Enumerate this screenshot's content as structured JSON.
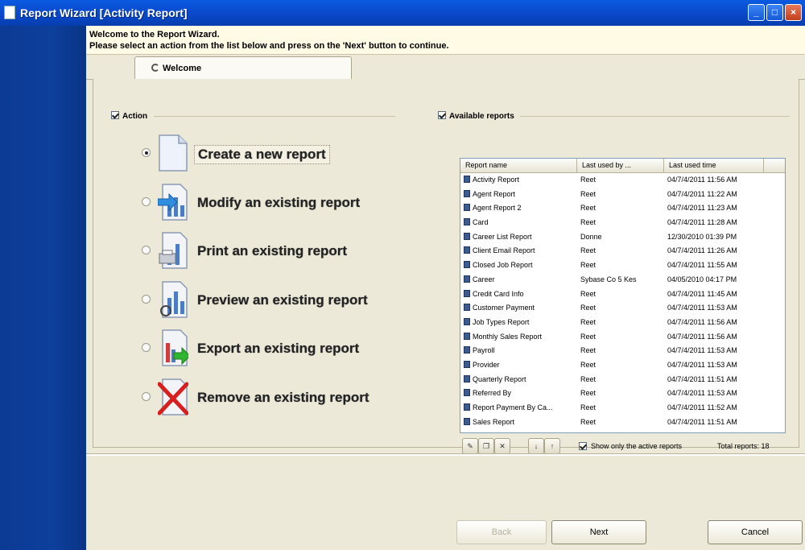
{
  "window": {
    "title": "Report Wizard [Activity Report]",
    "minimize": "_",
    "maximize": "□",
    "close": "×"
  },
  "header": {
    "line1": "Welcome to the Report Wizard.",
    "line2": "Please select an action from the list below and press on the 'Next' button to continue."
  },
  "tab": {
    "label": "Welcome"
  },
  "action_group": {
    "title": "Action"
  },
  "actions": [
    {
      "label": "Create a new report",
      "selected": true
    },
    {
      "label": "Modify an existing report",
      "selected": false
    },
    {
      "label": "Print an existing report",
      "selected": false
    },
    {
      "label": "Preview an existing report",
      "selected": false
    },
    {
      "label": "Export an existing report",
      "selected": false
    },
    {
      "label": "Remove an existing report",
      "selected": false
    }
  ],
  "reports_group": {
    "title": "Available reports"
  },
  "reports_table": {
    "columns": [
      "Report name",
      "Last used by ...",
      "Last used time"
    ],
    "rows": [
      [
        "Activity Report",
        "Reet",
        "04/7/4/2011 11:56 AM"
      ],
      [
        "Agent Report",
        "Reet",
        "04/7/4/2011 11:22 AM"
      ],
      [
        "Agent Report 2",
        "Reet",
        "04/7/4/2011 11:23 AM"
      ],
      [
        "Card",
        "Reet",
        "04/7/4/2011 11:28 AM"
      ],
      [
        "Career List Report",
        "Donne",
        "12/30/2010 01:39 PM"
      ],
      [
        "Client Email Report",
        "Reet",
        "04/7/4/2011 11:26 AM"
      ],
      [
        "Closed Job Report",
        "Reet",
        "04/7/4/2011 11:55 AM"
      ],
      [
        "Career",
        "Sybase Co 5 Kes",
        "04/05/2010 04:17 PM"
      ],
      [
        "Credit Card Info",
        "Reet",
        "04/7/4/2011 11:45 AM"
      ],
      [
        "Customer Payment",
        "Reet",
        "04/7/4/2011 11:53 AM"
      ],
      [
        "Job Types Report",
        "Reet",
        "04/7/4/2011 11:56 AM"
      ],
      [
        "Monthly Sales Report",
        "Reet",
        "04/7/4/2011 11:56 AM"
      ],
      [
        "Payroll",
        "Reet",
        "04/7/4/2011 11:53 AM"
      ],
      [
        "Provider",
        "Reet",
        "04/7/4/2011 11:53 AM"
      ],
      [
        "Quarterly Report",
        "Reet",
        "04/7/4/2011 11:51 AM"
      ],
      [
        "Referred By",
        "Reet",
        "04/7/4/2011 11:53 AM"
      ],
      [
        "Report Payment By Ca...",
        "Reet",
        "04/7/4/2011 11:52 AM"
      ],
      [
        "Sales Report",
        "Reet",
        "04/7/4/2011 11:51 AM"
      ]
    ]
  },
  "list_options": {
    "show_active_label": "Show only the active reports",
    "total_label": "Total reports: 18"
  },
  "buttons": {
    "back": "Back",
    "next": "Next",
    "cancel": "Cancel"
  }
}
